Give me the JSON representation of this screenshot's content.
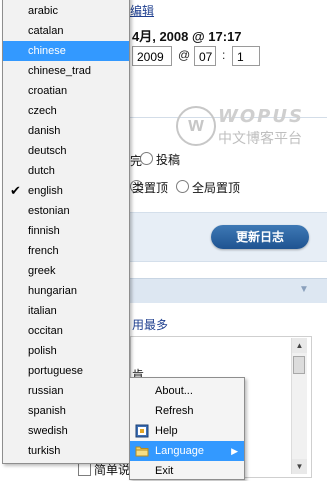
{
  "background": {
    "edit_link": "编辑",
    "datetime_text": "4月, 2008 @ 17:17",
    "time_fields": {
      "year": "2009",
      "at": "@",
      "hour": "07",
      "colon": ":",
      "minute": "1"
    },
    "options": [
      {
        "label": "投稿"
      },
      {
        "label": "类置顶"
      },
      {
        "label": "全局置顶"
      }
    ],
    "frag_a": "完",
    "publish_button": "更新日志",
    "collapse_icon": "chevron-down-icon",
    "most_used": "用最多",
    "frag_b": "肯",
    "frag_c": "简单说",
    "watermark": {
      "en": "WOPUS",
      "cn": "中文博客平台"
    }
  },
  "language_menu": {
    "selected": "chinese",
    "checked": "english",
    "items": [
      {
        "label": "arabic"
      },
      {
        "label": "catalan"
      },
      {
        "label": "chinese"
      },
      {
        "label": "chinese_trad"
      },
      {
        "label": "croatian"
      },
      {
        "label": "czech"
      },
      {
        "label": "danish"
      },
      {
        "label": "deutsch"
      },
      {
        "label": "dutch"
      },
      {
        "label": "english"
      },
      {
        "label": "estonian"
      },
      {
        "label": "finnish"
      },
      {
        "label": "french"
      },
      {
        "label": "greek"
      },
      {
        "label": "hungarian"
      },
      {
        "label": "italian"
      },
      {
        "label": "occitan"
      },
      {
        "label": "polish"
      },
      {
        "label": "portuguese"
      },
      {
        "label": "russian"
      },
      {
        "label": "spanish"
      },
      {
        "label": "swedish"
      },
      {
        "label": "turkish"
      }
    ]
  },
  "context_menu": {
    "items": [
      {
        "label": "About...",
        "icon": ""
      },
      {
        "label": "Refresh",
        "icon": ""
      },
      {
        "label": "Help",
        "icon": "help-book-icon"
      },
      {
        "label": "Language",
        "icon": "folder-icon",
        "submenu": true,
        "active": true
      },
      {
        "label": "Exit",
        "icon": ""
      }
    ]
  },
  "colors": {
    "highlight": "#3399ff",
    "button": "#2a62a1",
    "link": "#1f3f8f"
  }
}
